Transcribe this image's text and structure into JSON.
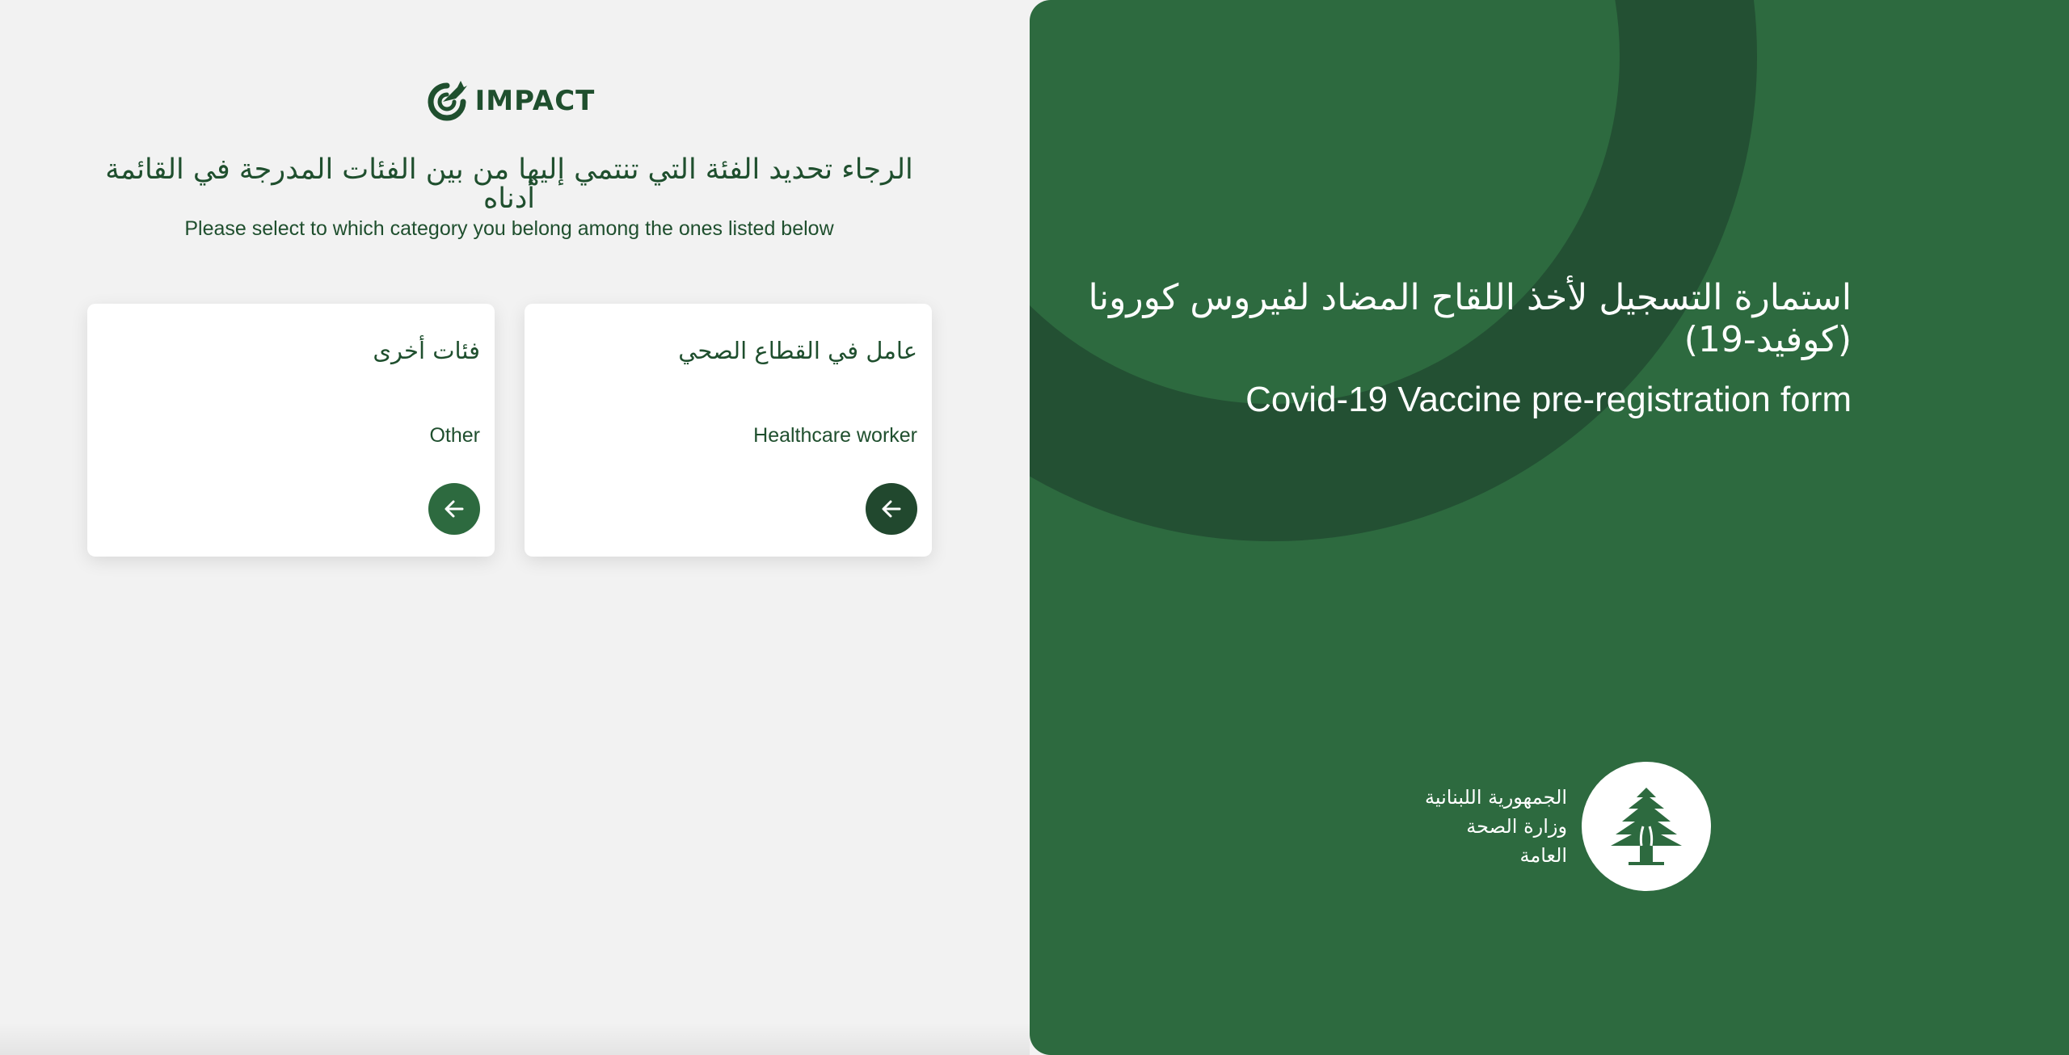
{
  "brand": {
    "name": "IMPACT",
    "color": "#1f4f2e"
  },
  "heading": {
    "arabic": "الرجاء تحديد الفئة التي تنتمي إليها من بين الفئات المدرجة في القائمة أدناه",
    "english": "Please select to which category you belong among the ones listed below"
  },
  "categories": [
    {
      "arabic": "عامل في القطاع الصحي",
      "english": "Healthcare worker",
      "action_icon": "arrow-left-icon",
      "button_color": "#21482e"
    },
    {
      "arabic": "فئات أخرى",
      "english": "Other",
      "action_icon": "arrow-left-icon",
      "button_color": "#2d6a3f"
    }
  ],
  "hero": {
    "arabic": "استمارة التسجيل لأخذ اللقاح المضاد لفيروس كورونا (كوفيد-19)",
    "english": "Covid-19 Vaccine pre-registration form"
  },
  "ministry": {
    "lines": [
      "الجمهورية اللبنانية",
      "وزارة الصحة",
      "العامة"
    ],
    "logo_icon": "cedar-tree-icon"
  },
  "colors": {
    "panel_green": "#2d6a3f",
    "decor_ring": "#235033",
    "text_green": "#1f4f2e",
    "background": "#f2f2f2"
  }
}
